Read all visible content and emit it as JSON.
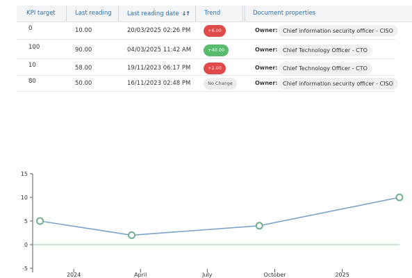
{
  "table": {
    "headers": {
      "kpi_target": "KPI target",
      "last_reading": "Last reading",
      "last_reading_date": "Last reading date",
      "sort_icon": "sort-arrows-icon",
      "trend": "Trend",
      "document_properties": "Document properties"
    },
    "rows": [
      {
        "kpi_target": "0",
        "last_reading": "10.00",
        "date": "20/03/2025 02:26 PM",
        "trend": "+6.00",
        "trend_type": "neg",
        "owner_label": "Owner:",
        "owner": "Chief information security officer - CISO"
      },
      {
        "kpi_target": "100",
        "last_reading": "90.00",
        "date": "04/03/2025 11:42 AM",
        "trend": "+40.00",
        "trend_type": "pos",
        "owner_label": "Owner:",
        "owner": "Chief Technology Officer - CTO"
      },
      {
        "kpi_target": "10",
        "last_reading": "58.00",
        "date": "19/11/2023 06:17 PM",
        "trend": "+2.00",
        "trend_type": "neg",
        "owner_label": "Owner:",
        "owner": "Chief Technology Officer - CTO"
      },
      {
        "kpi_target": "80",
        "last_reading": "50.00",
        "date": "16/11/2023 02:48 PM",
        "trend": "No Change",
        "trend_type": "neutral",
        "owner_label": "Owner:",
        "owner": "Chief information security officer - CISO"
      }
    ]
  },
  "chart_data": {
    "type": "line",
    "x_ticks": [
      "2024",
      "April",
      "July",
      "October",
      "2025"
    ],
    "y_ticks": [
      "15",
      "10",
      "5",
      "0",
      "-5"
    ],
    "ylim": [
      -5,
      15
    ],
    "x_dates": [
      "2023-11-16",
      "2024-03-20",
      "2024-09-10",
      "2025-03-20"
    ],
    "series": [
      {
        "values": [
          5,
          2,
          4,
          10
        ]
      }
    ],
    "baseline": 0,
    "colors": {
      "line": "#7aa3c9",
      "marker_stroke": "#6fae8e",
      "baseline": "#8fd09a",
      "axis": "#555555"
    }
  }
}
